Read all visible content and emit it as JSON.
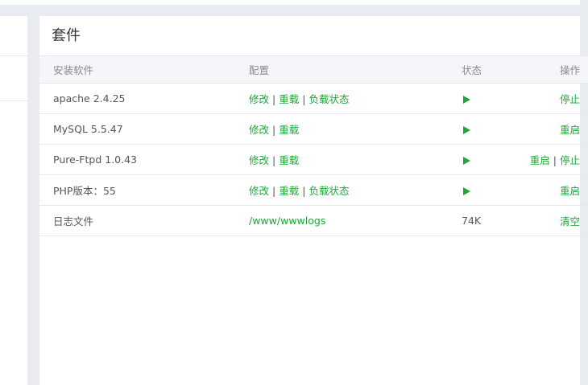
{
  "panel": {
    "title": "套件"
  },
  "headers": {
    "software": "安装软件",
    "config": "配置",
    "status": "状态",
    "actions": "操作"
  },
  "rows": [
    {
      "name": "apache 2.4.25",
      "config": [
        "修改",
        "重载",
        "负载状态"
      ],
      "status": "running",
      "actions": [
        "停止"
      ]
    },
    {
      "name": "MySQL 5.5.47",
      "config": [
        "修改",
        "重载"
      ],
      "status": "running",
      "actions": [
        "重启"
      ]
    },
    {
      "name": "Pure-Ftpd 1.0.43",
      "config": [
        "修改",
        "重载"
      ],
      "status": "running",
      "actions": [
        "重启",
        "停止"
      ]
    },
    {
      "name": "PHP版本：55",
      "config": [
        "修改",
        "重载",
        "负载状态"
      ],
      "status": "running",
      "actions": [
        "重启"
      ]
    },
    {
      "name": "日志文件",
      "config": [
        "/www/wwwlogs"
      ],
      "status_text": "74K",
      "actions": [
        "清空"
      ]
    }
  ],
  "colors": {
    "accent": "#20a53a",
    "background": "#e8ebef",
    "panel": "#ffffff"
  },
  "icons": {
    "running": "play-triangle-icon"
  }
}
